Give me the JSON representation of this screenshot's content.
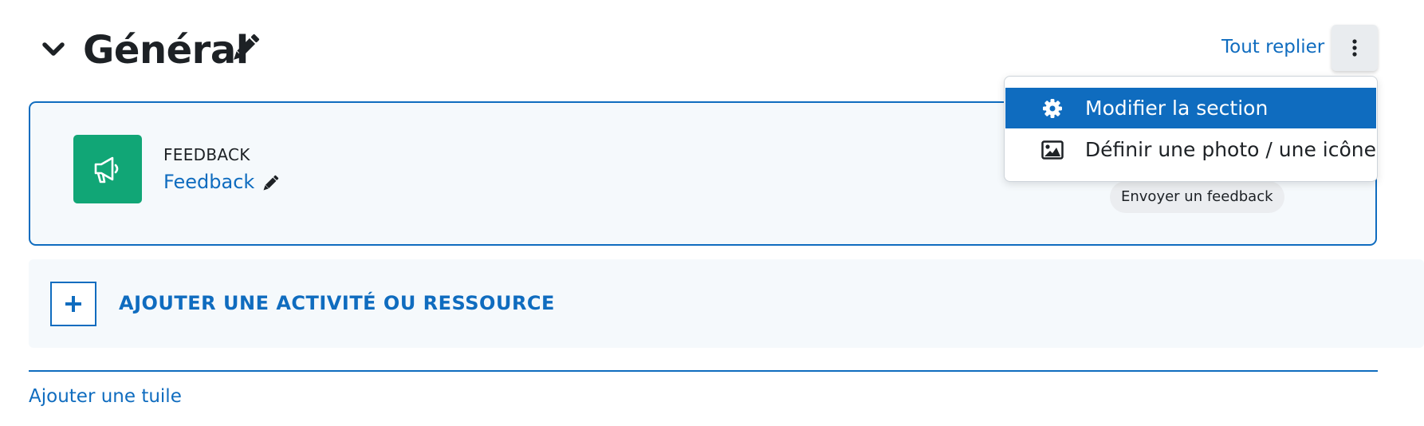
{
  "section": {
    "title": "Général",
    "collapse_all_label": "Tout replier"
  },
  "section_menu": {
    "items": [
      {
        "label": "Modifier la section",
        "icon": "gear-icon",
        "active": true
      },
      {
        "label": "Définir une photo / une icône",
        "icon": "image-icon",
        "active": false
      }
    ]
  },
  "activity": {
    "type_label": "FEEDBACK",
    "name": "Feedback",
    "icon": "megaphone-icon",
    "action_pill": "Envoyer un feedback"
  },
  "add_activity": {
    "label": "AJOUTER UNE ACTIVITÉ OU RESSOURCE"
  },
  "footer": {
    "add_tile_label": "Ajouter une tuile"
  },
  "colors": {
    "primary": "#0f6cbf",
    "activity_icon_bg": "#11a676",
    "card_bg": "#f5f9fc"
  }
}
